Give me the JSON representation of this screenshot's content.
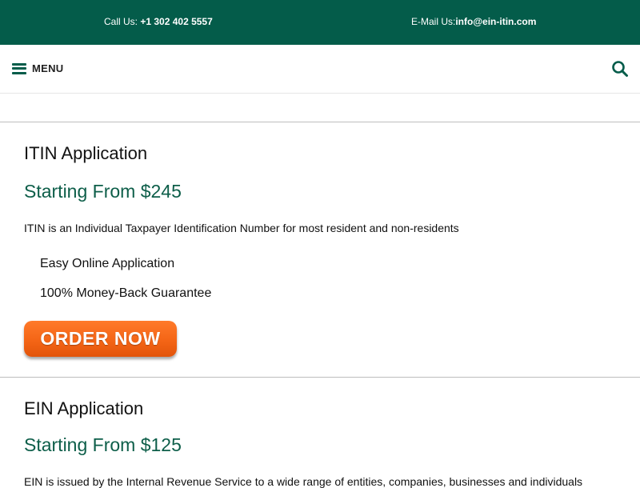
{
  "topbar": {
    "call_label": "Call Us:",
    "call_number": "+1 302 402 5557",
    "email_label": "E-Mail Us:",
    "email_address": "info@ein-itin.com"
  },
  "navbar": {
    "menu_label": "MENU",
    "menu_icon": "hamburger-icon",
    "search_icon": "search-icon"
  },
  "colors": {
    "brand_green": "#045c4a",
    "price_green": "#0d5e49",
    "order_orange": "#f46516"
  },
  "sections": [
    {
      "title": "ITIN Application",
      "price": "Starting From $245",
      "description": "ITIN is an Individual Taxpayer Identification Number for most resident and non-residents",
      "features": [
        "Easy Online Application",
        "100% Money-Back Guarantee"
      ],
      "button": "ORDER NOW"
    },
    {
      "title": "EIN Application",
      "price": "Starting From $125",
      "description": "EIN is issued by the Internal Revenue Service to a wide range of entities, companies, businesses and individuals"
    }
  ]
}
